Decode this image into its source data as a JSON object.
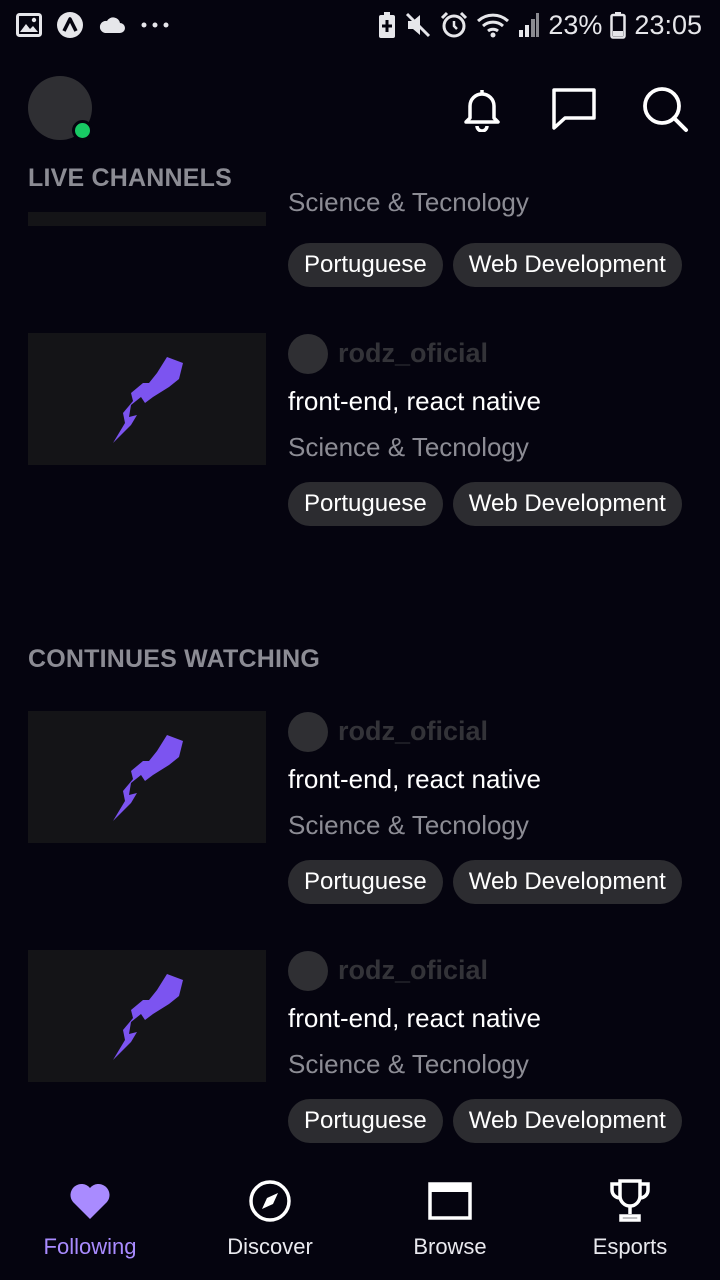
{
  "status_bar": {
    "battery": "23%",
    "time": "23:05",
    "left_icons": [
      "image-icon",
      "arch-app-icon",
      "cloud-icon",
      "more-dots-icon"
    ],
    "right_icons": [
      "battery-saver-icon",
      "mute-icon",
      "alarm-icon",
      "wifi-icon",
      "signal-icon",
      "battery-icon"
    ]
  },
  "header": {
    "online_color": "#18c964",
    "actions": [
      "notifications-bell-icon",
      "messages-icon",
      "search-icon"
    ]
  },
  "sections": {
    "live": {
      "title": "LIVE CHANNELS"
    },
    "continues": {
      "title": "CONTINUES WATCHING"
    }
  },
  "partial_card": {
    "category": "Science & Tecnology",
    "tags": [
      "Portuguese",
      "Web Development"
    ]
  },
  "live_channels": [
    {
      "channel": "rodz_oficial",
      "title": "front-end, react native",
      "category": "Science & Tecnology",
      "tags": [
        "Portuguese",
        "Web Development"
      ]
    }
  ],
  "continue_watching": [
    {
      "channel": "rodz_oficial",
      "title": "front-end, react native",
      "category": "Science & Tecnology",
      "tags": [
        "Portuguese",
        "Web Development"
      ]
    },
    {
      "channel": "rodz_oficial",
      "title": "front-end, react native",
      "category": "Science & Tecnology",
      "tags": [
        "Portuguese",
        "Web Development"
      ]
    }
  ],
  "bottom_nav": {
    "items": [
      {
        "label": "Following",
        "icon": "heart-icon",
        "active": true
      },
      {
        "label": "Discover",
        "icon": "compass-icon",
        "active": false
      },
      {
        "label": "Browse",
        "icon": "browse-window-icon",
        "active": false
      },
      {
        "label": "Esports",
        "icon": "trophy-icon",
        "active": false
      }
    ]
  },
  "colors": {
    "background": "#05040f",
    "accent": "#a98bff",
    "thumbnail": "#141417",
    "tag_bg": "#2c2c30",
    "muted_text": "#8c8c94",
    "brand_logo": "#7c54f0"
  }
}
